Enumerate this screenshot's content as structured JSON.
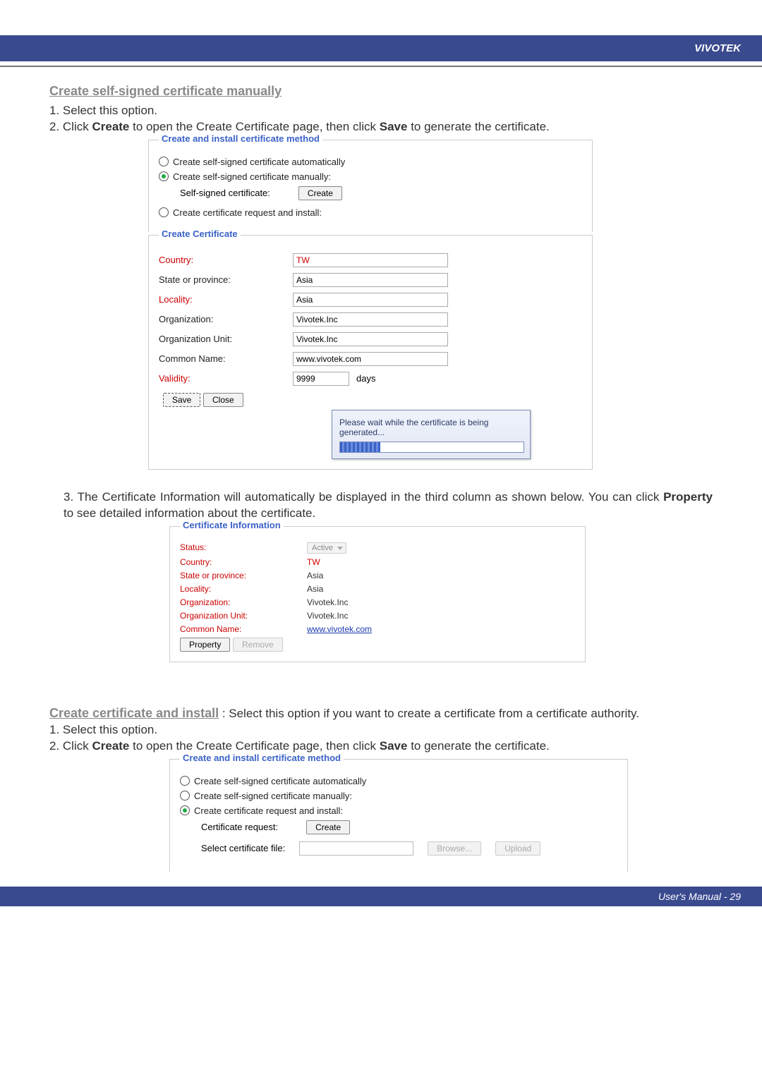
{
  "header": {
    "brand": "VIVOTEK"
  },
  "section1": {
    "title": "Create self-signed certificate manually",
    "step1": "1. Select this option.",
    "step2_a": "2. Click ",
    "step2_create": "Create",
    "step2_b": " to open the Create Certificate page, then click ",
    "step2_save": "Save",
    "step2_c": " to generate the certificate."
  },
  "methodBox1": {
    "legend": "Create and install certificate method",
    "opt_auto": "Create self-signed certificate automatically",
    "opt_manual": "Create self-signed certificate manually:",
    "row_self_label": "Self-signed certificate:",
    "create_btn": "Create",
    "opt_req": "Create certificate request and install:"
  },
  "createCert": {
    "legend": "Create Certificate",
    "fields": {
      "country_l": "Country:",
      "country_v": "TW",
      "state_l": "State or province:",
      "state_v": "Asia",
      "locality_l": "Locality:",
      "locality_v": "Asia",
      "org_l": "Organization:",
      "org_v": "Vivotek.Inc",
      "orgu_l": "Organization Unit:",
      "orgu_v": "Vivotek.Inc",
      "cn_l": "Common Name:",
      "cn_v": "www.vivotek.com",
      "validity_l": "Validity:",
      "validity_v": "9999",
      "validity_unit": "days"
    },
    "save": "Save",
    "close": "Close",
    "status_msg": "Please wait while the certificate is being generated..."
  },
  "section2": {
    "num": "3. ",
    "text_a": "The Certificate Information will automatically be displayed in the third column as shown below. You can click ",
    "prop": "Property",
    "text_b": " to see detailed information about the certificate."
  },
  "certInfo": {
    "legend": "Certificate Information",
    "status_l": "Status:",
    "status_v": "Active",
    "country_l": "Country:",
    "country_v": "TW",
    "state_l": "State or province:",
    "state_v": "Asia",
    "locality_l": "Locality:",
    "locality_v": "Asia",
    "org_l": "Organization:",
    "org_v": "Vivotek.Inc",
    "orgu_l": "Organization Unit:",
    "orgu_v": "Vivotek.Inc",
    "cn_l": "Common Name:",
    "cn_v": "www.vivotek.com",
    "property_btn": "Property",
    "remove_btn": "Remove"
  },
  "section3": {
    "title": "Create certificate and install",
    "rest": " :  Select this option if you want to create a certificate from a certificate authority.",
    "step1": "1. Select this option.",
    "step2_a": "2. Click ",
    "step2_create": "Create",
    "step2_b": " to open the Create Certificate page, then click ",
    "step2_save": "Save",
    "step2_c": " to generate the certificate."
  },
  "methodBox2": {
    "legend": "Create and install certificate method",
    "opt_auto": "Create self-signed certificate automatically",
    "opt_manual": "Create self-signed certificate manually:",
    "opt_req": "Create certificate request and install:",
    "row_req_label": "Certificate request:",
    "create_btn": "Create",
    "row_file_label": "Select certificate file:",
    "browse_btn": "Browse...",
    "upload_btn": "Upload"
  },
  "footer": {
    "text": "User's Manual - 29"
  }
}
